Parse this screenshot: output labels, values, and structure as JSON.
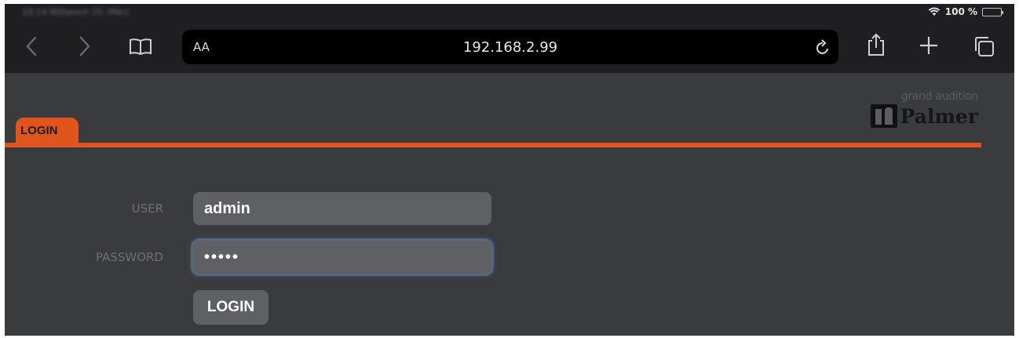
{
  "status_bar": {
    "left_text": "10:14 Mittwoch 25. März",
    "battery_percent": "100 %"
  },
  "browser": {
    "text_size_button": "AA",
    "url": "192.168.2.99"
  },
  "page": {
    "tab_label": "LOGIN",
    "brand_tagline": "grand audition",
    "brand_name": "Palmer",
    "user_label": "USER",
    "user_value": "admin",
    "password_label": "PASSWORD",
    "password_value": "•••••",
    "login_button": "LOGIN"
  },
  "colors": {
    "accent": "#e0541d",
    "background": "#3a3b3d",
    "toolbar": "#1f1f21",
    "input": "#5f6063"
  }
}
